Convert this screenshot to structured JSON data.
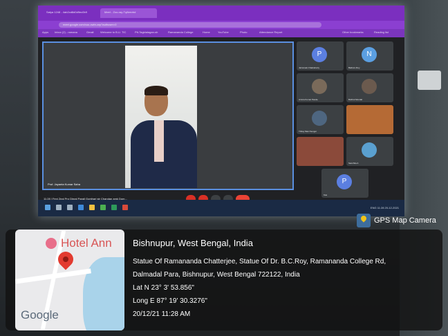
{
  "browser": {
    "tabs": [
      "Satya 1248 - 4ab2cd8d0d9ec0b9",
      "Meet - Zoo-ray-Tq8eevbd"
    ],
    "address": "meet.google.com/xuo-cwbr-arp?authuser=0",
    "bookmarks": [
      "Apps",
      "Inbox (2) - ramana",
      "Gmail",
      "Welcome to B.U. TIC",
      "Ptt-Tagidalagan-sh",
      "Ramananda College",
      "Home",
      "YouTube",
      "Photo",
      "Attendance Report",
      "Other bookmarks",
      "Reading list"
    ]
  },
  "meet": {
    "main_speaker_name": "Prof. Jayanta Kumar Saha",
    "participants": [
      {
        "label": "Jaironsak Chakraborty",
        "initial": "P",
        "color": "#5b7fe1"
      },
      {
        "label": "Baiboru Roy",
        "initial": "N",
        "color": "#5b9fe1"
      },
      {
        "label": "Arnica Kumar Pande",
        "initial": "",
        "color": "#3c4043"
      },
      {
        "label": "Bubhul Mondal",
        "initial": "",
        "color": "#3c4043"
      },
      {
        "label": "Tribay Mani Sengor",
        "initial": "",
        "color": "#3c4043"
      },
      {
        "label": "",
        "initial": "",
        "color": "#b56a35"
      },
      {
        "label": "",
        "initial": "",
        "color": "#8b4a3a"
      },
      {
        "label": "Sanchita A",
        "initial": "",
        "color": "#3c4043"
      },
      {
        "label": "Kas",
        "initial": "P",
        "color": "#5b7fe1"
      }
    ],
    "meeting_info": "11:28 | Feni Zeal Pro Dinral Parali Gonthari str Chandan amk Dom..."
  },
  "taskbar": {
    "tray": "ENG 11:28 20-12-2021"
  },
  "gps": {
    "badge": "GPS Map Camera",
    "location_title": "Bishnupur, West Bengal, India",
    "address_lines": [
      "Statue Of Ramananda Chatterjee, Statue Of Dr. B.C.Roy, Ramananda College Rd,",
      "Dalmadal Para, Bishnupur, West Bengal 722122, India"
    ],
    "lat": "Lat N 23° 3' 53.856\"",
    "long": "Long E 87° 19' 30.3276\"",
    "datetime": "20/12/21 11:28 AM",
    "map_label": "Hotel Ann",
    "map_brand": "Google"
  }
}
